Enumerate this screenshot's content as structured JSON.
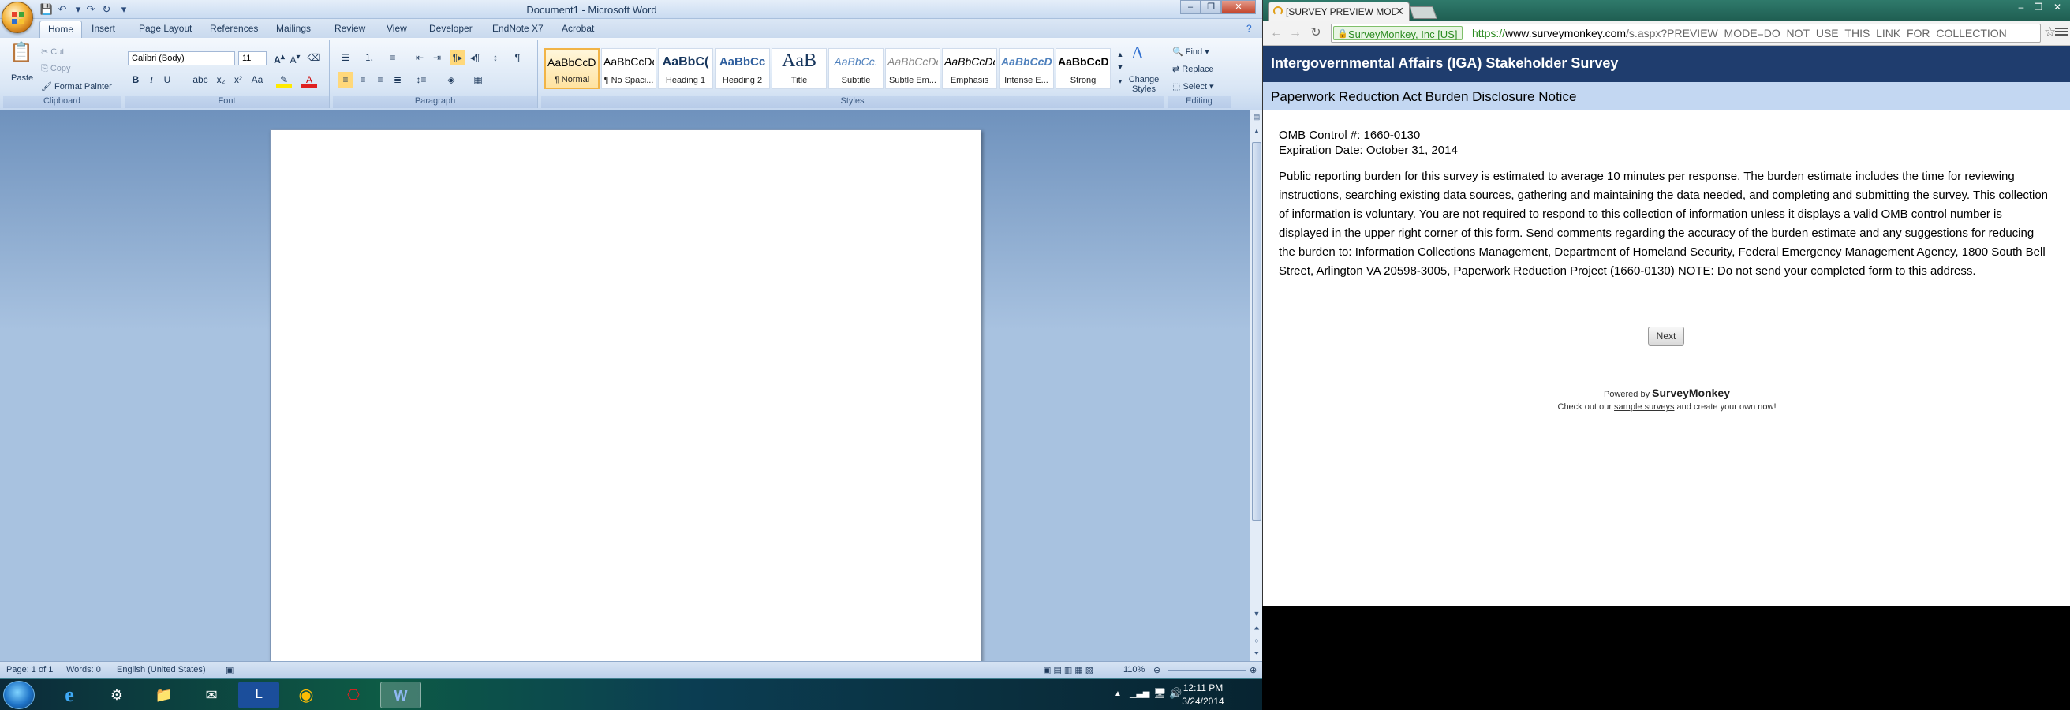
{
  "word": {
    "title": "Document1 - Microsoft Word",
    "tabs": [
      "Home",
      "Insert",
      "Page Layout",
      "References",
      "Mailings",
      "Review",
      "View",
      "Developer",
      "EndNote X7",
      "Acrobat"
    ],
    "clipboard": {
      "paste": "Paste",
      "cut": "Cut",
      "copy": "Copy",
      "format_painter": "Format Painter",
      "label": "Clipboard"
    },
    "font": {
      "name": "Calibri (Body)",
      "size": "11",
      "label": "Font"
    },
    "paragraph_label": "Paragraph",
    "styles": [
      {
        "sample": "AaBbCcDc",
        "name": "¶ Normal"
      },
      {
        "sample": "AaBbCcDc",
        "name": "¶ No Spaci..."
      },
      {
        "sample": "AaBbC(",
        "name": "Heading 1"
      },
      {
        "sample": "AaBbCc",
        "name": "Heading 2"
      },
      {
        "sample": "AaB",
        "name": "Title"
      },
      {
        "sample": "AaBbCc.",
        "name": "Subtitle"
      },
      {
        "sample": "AaBbCcDc",
        "name": "Subtle Em..."
      },
      {
        "sample": "AaBbCcDc",
        "name": "Emphasis"
      },
      {
        "sample": "AaBbCcDc",
        "name": "Intense E..."
      },
      {
        "sample": "AaBbCcDc",
        "name": "Strong"
      }
    ],
    "change_styles": "Change Styles",
    "styles_label": "Styles",
    "editing": {
      "find": "Find",
      "replace": "Replace",
      "select": "Select",
      "label": "Editing"
    },
    "status": {
      "page": "Page: 1 of 1",
      "words": "Words: 0",
      "language": "English (United States)",
      "zoom": "110%"
    }
  },
  "taskbar": {
    "time": "12:11 PM",
    "date": "3/24/2014"
  },
  "chrome": {
    "tab_title": "[SURVEY PREVIEW MODE]",
    "ev_cert": "SurveyMonkey, Inc [US]",
    "url_scheme": "https://",
    "url_host": "www.surveymonkey.com",
    "url_path": "/s.aspx?PREVIEW_MODE=DO_NOT_USE_THIS_LINK_FOR_COLLECTION"
  },
  "survey": {
    "title": "Intergovernmental Affairs (IGA) Stakeholder Survey",
    "notice_title": "Paperwork Reduction Act Burden Disclosure Notice",
    "omb_control": "OMB Control #: 1660-0130",
    "expiration": "Expiration Date: October 31, 2014",
    "body": "Public reporting burden for this survey is estimated to average 10 minutes per response. The burden estimate includes the time for reviewing instructions, searching existing data sources, gathering and maintaining the data needed, and completing and submitting the survey. This collection of information is voluntary. You are not required to respond to this collection of information unless it displays a valid OMB control number is displayed in the upper right corner of this form. Send comments regarding the accuracy of the burden estimate and any suggestions for reducing the burden to: Information Collections Management, Department of Homeland Security, Federal Emergency Management Agency, 1800 South Bell Street, Arlington VA 20598-3005, Paperwork Reduction Project (1660-0130) NOTE: Do not send your completed form to this address.",
    "next_label": "Next",
    "powered_by": "Powered by",
    "brand": "SurveyMonkey",
    "checkout_pre": "Check out our",
    "checkout_link": "sample surveys",
    "checkout_post": "and create your own now!"
  }
}
